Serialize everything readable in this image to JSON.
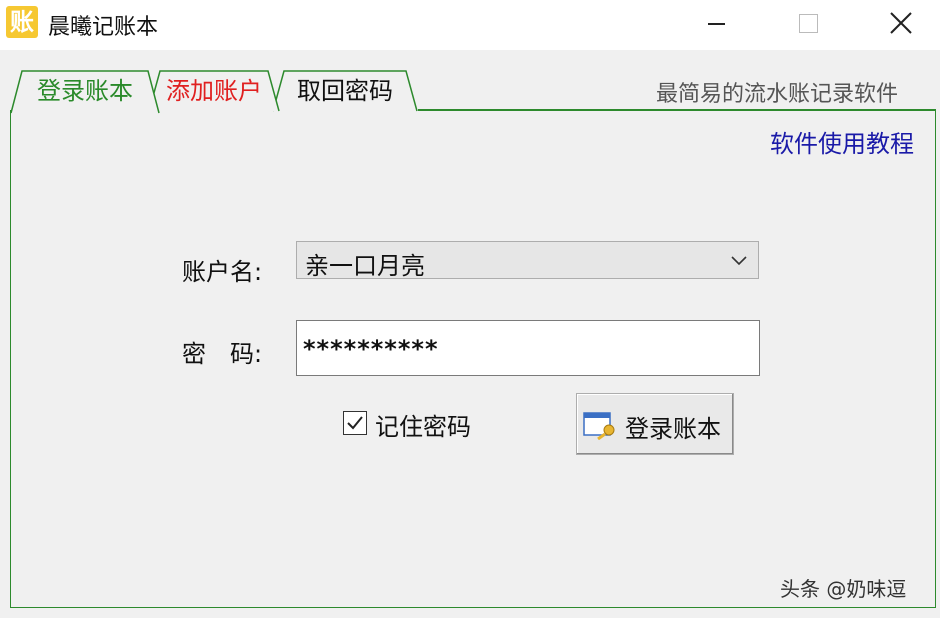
{
  "window": {
    "title": "晨曦记账本",
    "icon_char": "账",
    "icon_color": "#f6c832"
  },
  "tabs": [
    {
      "label": "登录账本",
      "color": "#2a8a2a",
      "active": true
    },
    {
      "label": "添加账户",
      "color": "#e02020",
      "active": false
    },
    {
      "label": "取回密码",
      "color": "#111111",
      "active": false
    }
  ],
  "slogan": "最简易的流水账记录软件",
  "tutorial_link": "软件使用教程",
  "form": {
    "username_label": "账户名:",
    "username_value": "亲一口月亮",
    "password_label": "密　码:",
    "password_value": "**********",
    "remember_label": "记住密码",
    "remember_checked": true,
    "login_button": "登录账本"
  },
  "watermark": "头条 @奶味逗",
  "colors": {
    "accent_green": "#2d8a2d",
    "link_blue": "#1a1aa8"
  }
}
